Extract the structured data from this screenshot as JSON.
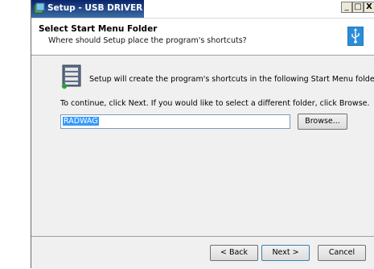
{
  "window": {
    "title": "Setup - USB DRIVER",
    "minimize_label": "_",
    "maximize_label": "□",
    "close_label": "X"
  },
  "header": {
    "title": "Select Start Menu Folder",
    "subtitle": "Where should Setup place the program's shortcuts?"
  },
  "content": {
    "intro": "Setup will create the program's shortcuts in the following Start Menu folder.",
    "instructions": "To continue, click Next. If you would like to select a different folder, click Browse.",
    "folder_value": "RADWAG",
    "browse_label": "Browse..."
  },
  "footer": {
    "back_label": "< Back",
    "next_label": "Next >",
    "cancel_label": "Cancel"
  },
  "colors": {
    "title_bar": "#0a246a",
    "selection": "#3399ff",
    "dialog_bg": "#f0f0f0"
  },
  "icons": [
    "setup-app-icon",
    "usb-icon",
    "start-menu-folder-icon"
  ]
}
